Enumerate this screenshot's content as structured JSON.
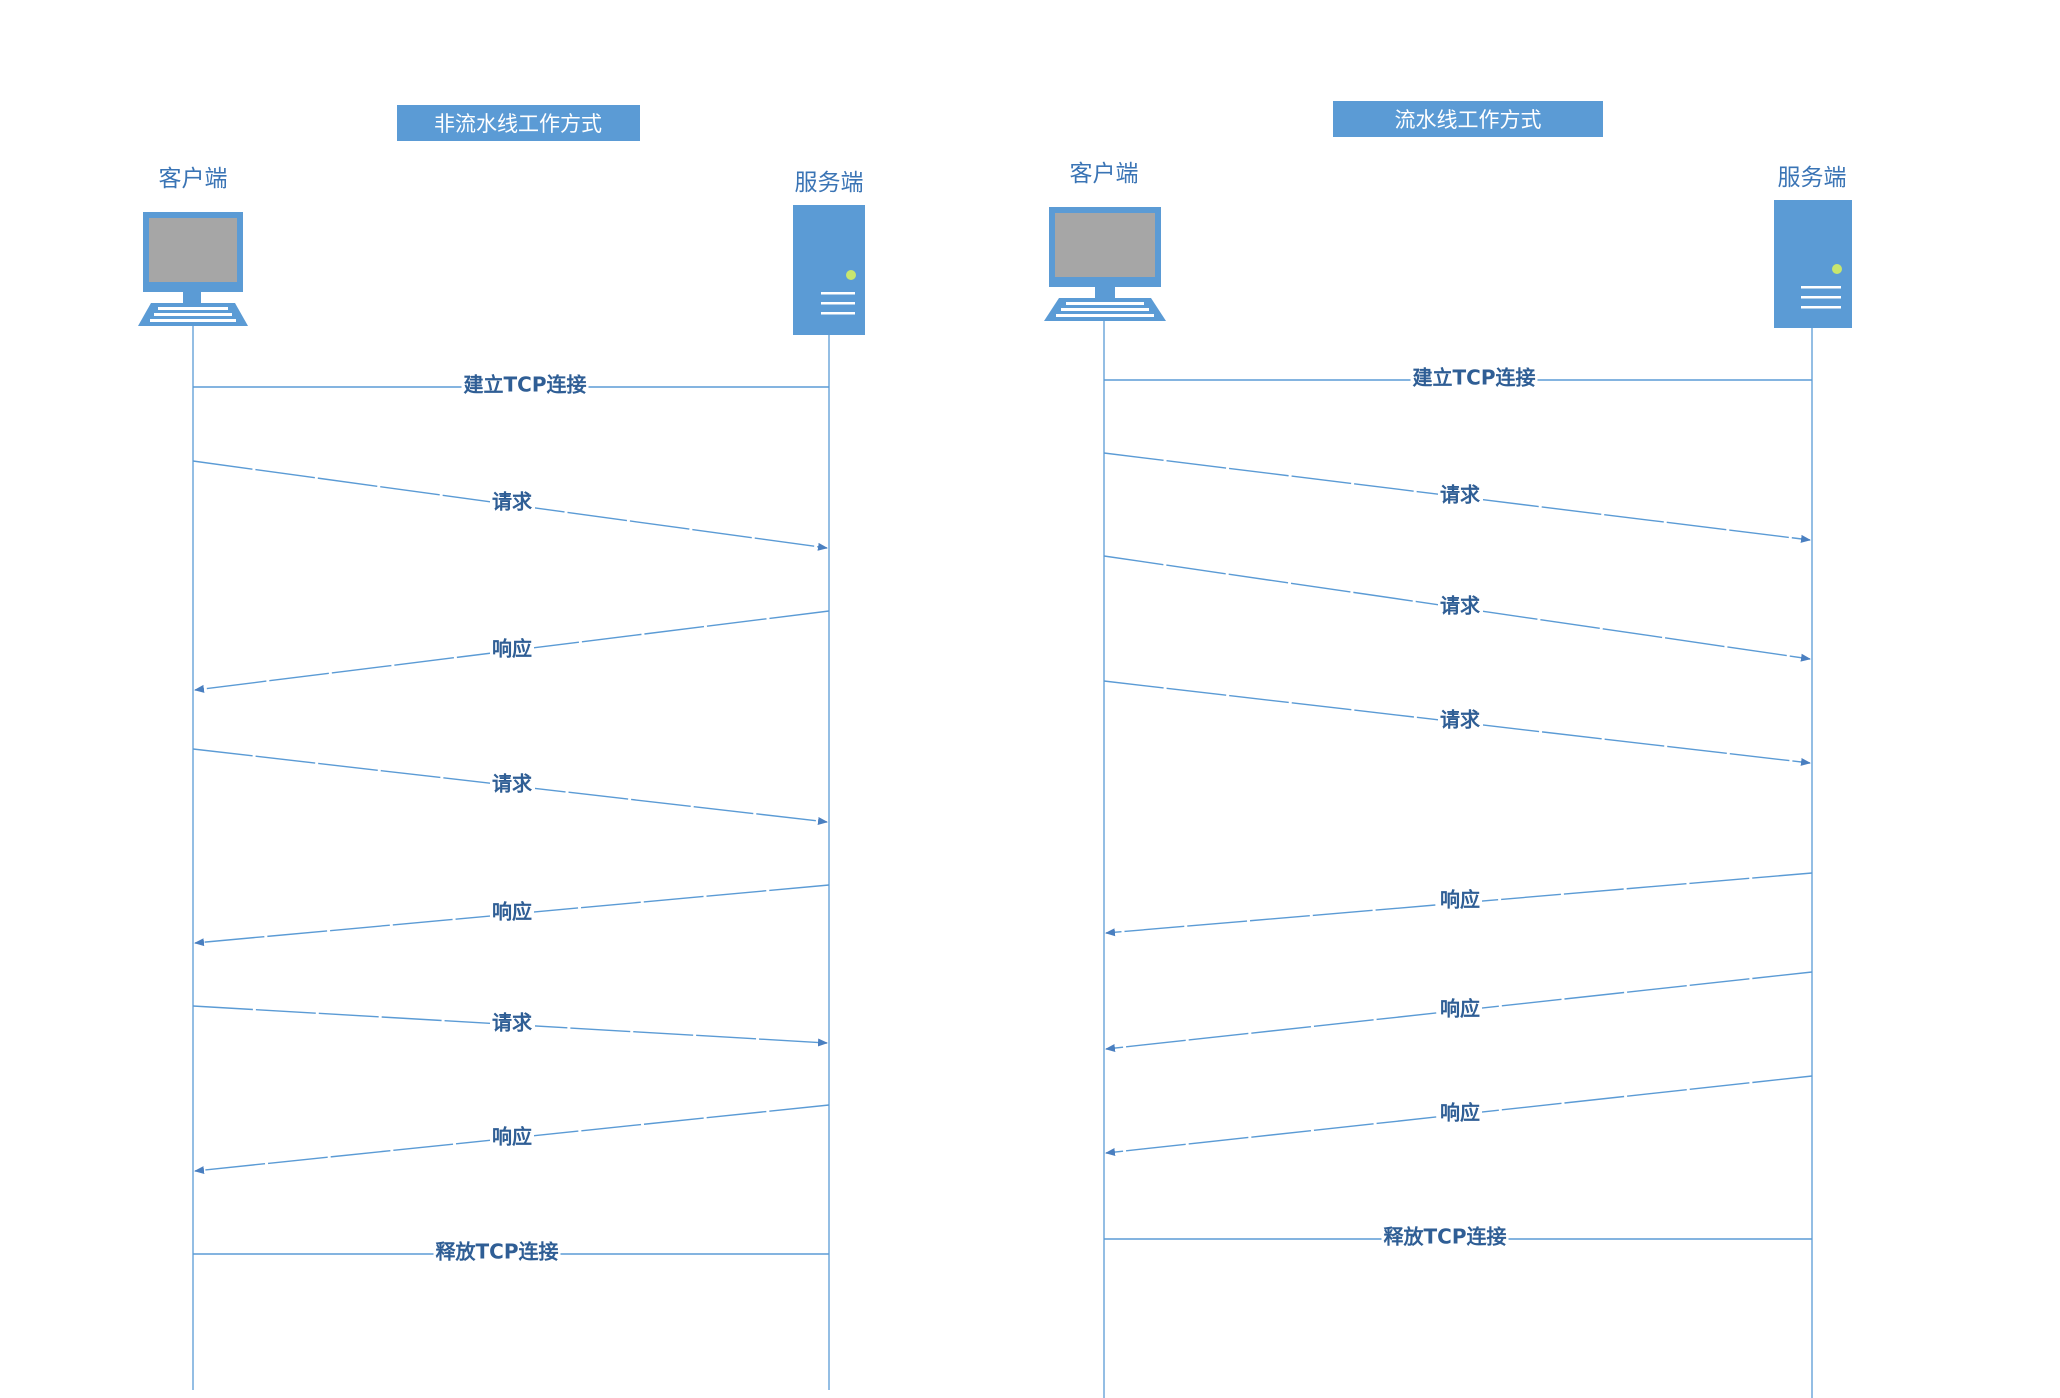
{
  "colors": {
    "line": "#5b9bd5",
    "text": "#2f5e95",
    "title_bg": "#5b9bd5",
    "icon_fill": "#5b9bd5",
    "screen": "#a6a6a6",
    "led": "#c8e66e"
  },
  "left": {
    "title": "非流水线工作方式",
    "client_label": "客户端",
    "server_label": "服务端",
    "messages": [
      {
        "label": "建立TCP连接",
        "type": "setup"
      },
      {
        "label": "请求",
        "type": "request"
      },
      {
        "label": "响应",
        "type": "response"
      },
      {
        "label": "请求",
        "type": "request"
      },
      {
        "label": "响应",
        "type": "response"
      },
      {
        "label": "请求",
        "type": "request"
      },
      {
        "label": "响应",
        "type": "response"
      },
      {
        "label": "释放TCP连接",
        "type": "teardown"
      }
    ]
  },
  "right": {
    "title": "流水线工作方式",
    "client_label": "客户端",
    "server_label": "服务端",
    "messages": [
      {
        "label": "建立TCP连接",
        "type": "setup"
      },
      {
        "label": "请求",
        "type": "request"
      },
      {
        "label": "请求",
        "type": "request"
      },
      {
        "label": "请求",
        "type": "request"
      },
      {
        "label": "响应",
        "type": "response"
      },
      {
        "label": "响应",
        "type": "response"
      },
      {
        "label": "响应",
        "type": "response"
      },
      {
        "label": "释放TCP连接",
        "type": "teardown"
      }
    ]
  }
}
